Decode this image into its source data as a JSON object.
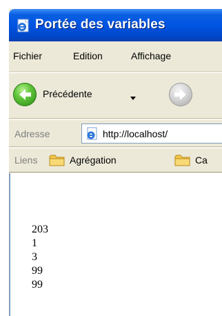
{
  "window": {
    "title": "Portée des variables",
    "title_icon": "ie-page-icon"
  },
  "menu": {
    "items": [
      "Fichier",
      "Edition",
      "Affichage"
    ]
  },
  "toolbar": {
    "back_label": "Précédente",
    "back_icon": "back-arrow-icon",
    "forward_icon": "forward-arrow-icon",
    "accent_back": "#3aa71d",
    "accent_forward": "#b5b5b5"
  },
  "address": {
    "label": "Adresse",
    "url": "http://localhost/"
  },
  "links": {
    "label": "Liens",
    "items": [
      {
        "label": "Agrégation",
        "icon": "folder-icon"
      },
      {
        "label": "Ca",
        "icon": "folder-icon"
      }
    ]
  },
  "page": {
    "lines": [
      "203",
      "1",
      "3",
      "99",
      "99"
    ]
  }
}
